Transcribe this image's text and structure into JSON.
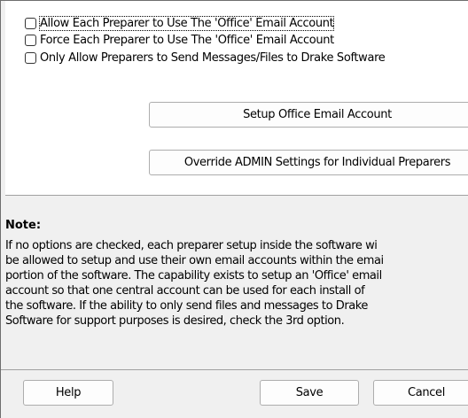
{
  "options": [
    {
      "label": "Allow Each Preparer to Use The 'Office' Email Account",
      "checked": false
    },
    {
      "label": "Force Each Preparer to Use The 'Office' Email Account",
      "checked": false
    },
    {
      "label": "Only Allow Preparers to Send Messages/Files to Drake Software",
      "checked": false
    }
  ],
  "buttons": {
    "setup_office": "Setup Office Email Account",
    "override_admin": "Override ADMIN Settings for Individual Preparers",
    "help": "Help",
    "save": "Save",
    "cancel": "Cancel"
  },
  "note": {
    "title": "Note:",
    "lines": [
      "If no options are checked, each preparer setup inside the software wi",
      "be allowed to setup and use their own email accounts within the emai",
      "portion of the software. The capability exists to setup an 'Office' email",
      "account so that one central account can be used for each install of",
      "the software. If the ability to only send files and messages to Drake",
      "Software for support purposes is desired, check the 3rd option."
    ]
  }
}
